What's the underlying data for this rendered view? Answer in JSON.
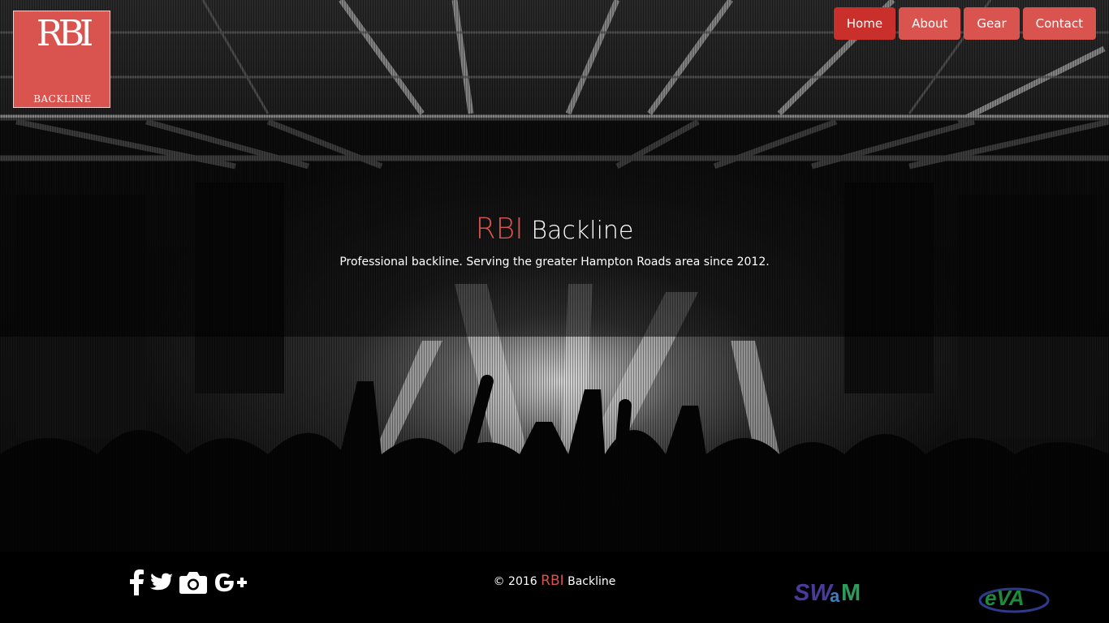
{
  "logo": {
    "letters": "RBI",
    "sub": "BACKLINE"
  },
  "nav": [
    {
      "label": "Home",
      "active": true
    },
    {
      "label": "About"
    },
    {
      "label": "Gear"
    },
    {
      "label": "Contact"
    }
  ],
  "hero": {
    "title_accent": "RBI",
    "title_rest": "Backline",
    "subtitle": "Professional backline. Serving the greater Hampton Roads area since 2012."
  },
  "footer": {
    "social": [
      "facebook-icon",
      "twitter-icon",
      "camera-icon",
      "google-plus-icon"
    ],
    "copyright_prefix": "© 2016",
    "copyright_accent": "RBI",
    "copyright_suffix": "Backline",
    "partners": [
      {
        "name": "swam-logo",
        "text": "SWaM"
      },
      {
        "name": "eva-logo",
        "text": "eVA"
      }
    ]
  },
  "colors": {
    "accent": "#d9534f",
    "accent_dark": "#c9302c",
    "footer_bg": "#000000"
  }
}
